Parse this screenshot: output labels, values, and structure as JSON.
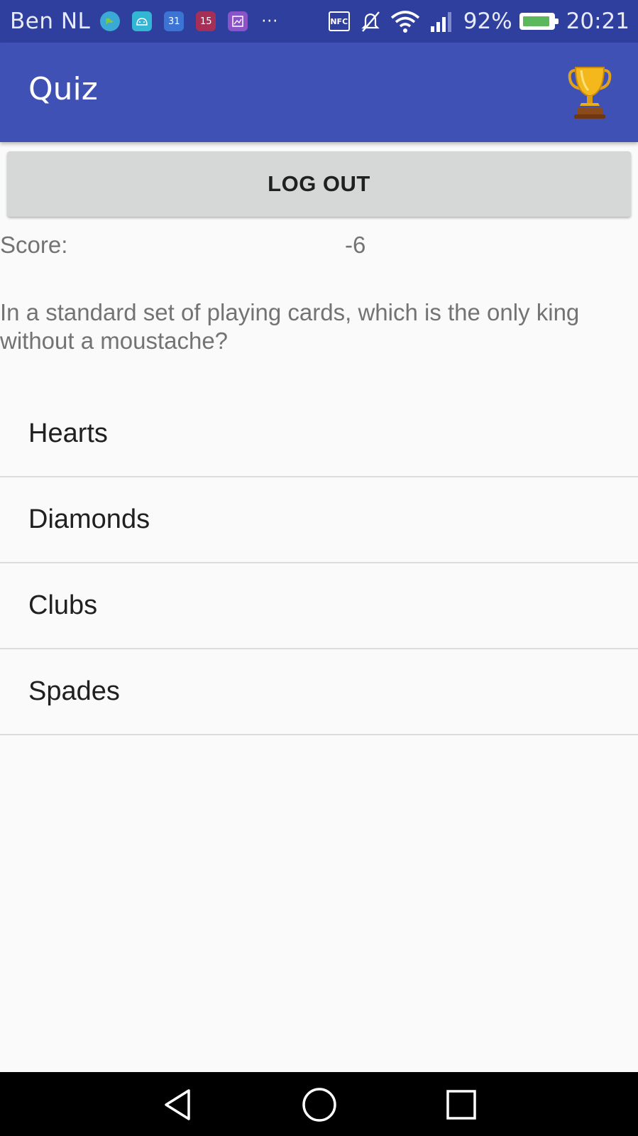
{
  "status_bar": {
    "carrier": "Ben NL",
    "notification_icons": [
      "globe-icon",
      "android-icon",
      "calendar-icon",
      "number-badge-icon",
      "image-icon"
    ],
    "calendar_day": "31",
    "badge_number": "15",
    "more": "···",
    "nfc_label": "NFC",
    "battery_percent": "92%",
    "battery_level": 0.92,
    "time": "20:21"
  },
  "app_bar": {
    "title": "Quiz",
    "action_icon": "trophy-icon",
    "background": "#3f51b5"
  },
  "logout_button": {
    "label": "LOG OUT"
  },
  "score": {
    "label": "Score:",
    "value": "-6"
  },
  "question": {
    "text": "In a standard set of playing cards, which is the only king without a moustache?"
  },
  "answers": [
    {
      "label": "Hearts"
    },
    {
      "label": "Diamonds"
    },
    {
      "label": "Clubs"
    },
    {
      "label": "Spades"
    }
  ],
  "nav_bar": {
    "buttons": [
      "back-icon",
      "home-icon",
      "recents-icon"
    ]
  }
}
